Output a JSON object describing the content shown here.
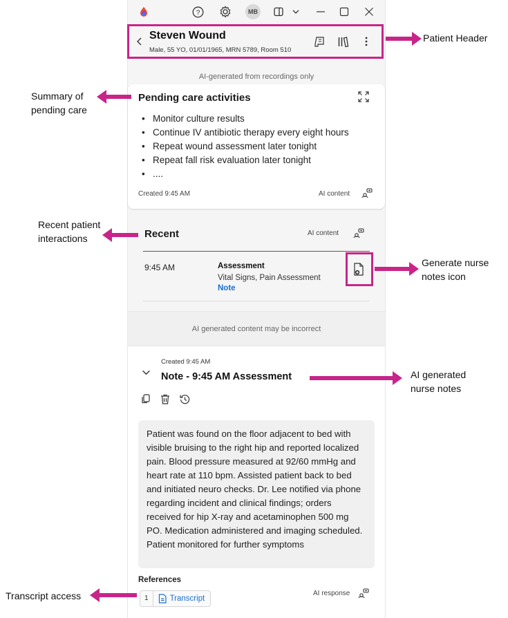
{
  "titlebar": {
    "avatar_initials": "MB",
    "icons": [
      "app-logo-icon",
      "help-icon",
      "settings-icon",
      "panel-icon",
      "chevron-down-icon",
      "minimize-icon",
      "maximize-icon",
      "close-icon"
    ]
  },
  "patient": {
    "name": "Steven Wound",
    "meta": "Male, 55 YO, 01/01/1965, MRN 5789, Room 510"
  },
  "ai_note_top": "AI-generated from recordings only",
  "pending": {
    "title": "Pending care activities",
    "items": [
      "Monitor culture results",
      "Continue IV antibiotic therapy every eight hours",
      "Repeat wound assessment later tonight",
      "Repeat fall risk evaluation later tonight",
      "...."
    ],
    "created": "Created 9:45 AM",
    "ai_label": "AI content"
  },
  "recent": {
    "title": "Recent",
    "ai_label": "AI content",
    "time": "9:45 AM",
    "type": "Assessment",
    "detail": "Vital Signs, Pain Assessment",
    "link": "Note"
  },
  "ai_disclaimer": "AI generated content may be incorrect",
  "note": {
    "created": "Created  9:45 AM",
    "title": "Note - 9:45 AM  Assessment",
    "body": "Patient was found on the floor adjacent to bed with visible bruising to the right hip and reported localized pain. Blood pressure measured at 92/60 mmHg and heart rate at 110 bpm. Assisted patient back to bed and initiated neuro checks. Dr. Lee notified via phone regarding incident and clinical findings; orders received for hip X-ray and acetaminophen 500 mg PO. Medication administered and imaging scheduled. Patient monitored for further symptoms",
    "references_label": "References",
    "ref_number": "1",
    "ref_text": "Transcript",
    "ai_response_label": "AI response"
  },
  "annotations": {
    "patient_header": "Patient Header",
    "summary": "Summary of pending care",
    "recent": "Recent patient interactions",
    "generate": "Generate nurse notes icon",
    "ai_notes": "AI generated nurse notes",
    "transcript": "Transcript access"
  },
  "colors": {
    "annotation": "#c7258a",
    "link": "#1a6fd1",
    "panel_bg": "#f5f5f5"
  }
}
